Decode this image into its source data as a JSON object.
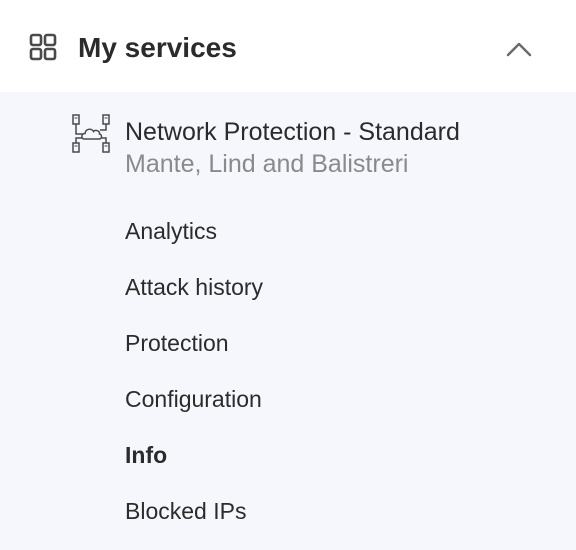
{
  "header": {
    "title": "My services",
    "expanded": true
  },
  "service": {
    "name": "Network Protection - Standard",
    "organization": "Mante, Lind and Balistreri"
  },
  "menu": {
    "items": [
      {
        "label": "Analytics",
        "active": false
      },
      {
        "label": "Attack history",
        "active": false
      },
      {
        "label": "Protection",
        "active": false
      },
      {
        "label": "Configuration",
        "active": false
      },
      {
        "label": "Info",
        "active": true
      },
      {
        "label": "Blocked IPs",
        "active": false
      }
    ]
  },
  "colors": {
    "text": "#2b2b2b",
    "muted": "#8a8a8a",
    "panel_bg": "#f5f7fd",
    "icon": "#4a4a4a"
  },
  "icons": {
    "header": "grid-icon",
    "toggle": "chevron-up-icon",
    "service": "network-icon"
  }
}
